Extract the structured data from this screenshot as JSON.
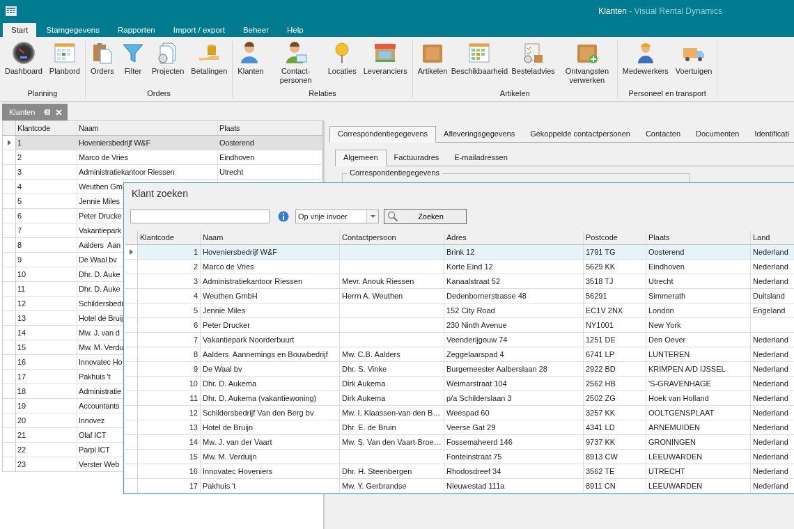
{
  "window": {
    "title": "Klanten",
    "app": "- Visual Rental Dynamics"
  },
  "menu_tabs": [
    {
      "label": "Start",
      "selected": true
    },
    {
      "label": "Stamgegevens",
      "selected": false
    },
    {
      "label": "Rapporten",
      "selected": false
    },
    {
      "label": "Import / export",
      "selected": false
    },
    {
      "label": "Beheer",
      "selected": false
    },
    {
      "label": "Help",
      "selected": false
    }
  ],
  "ribbon": [
    {
      "group": "Planning",
      "buttons": [
        "Dashboard",
        "Planbord"
      ]
    },
    {
      "group": "Orders",
      "buttons": [
        "Orders",
        "Filter",
        "Projecten",
        "Betalingen"
      ]
    },
    {
      "group": "Relaties",
      "buttons": [
        "Klanten",
        "Contact-personen",
        "Locaties",
        "Leveranciers"
      ]
    },
    {
      "group": "Artikelen",
      "buttons": [
        "Artikelen",
        "Beschikbaarheid",
        "Besteladvies",
        "Ontvangsten verwerken"
      ]
    },
    {
      "group": "Personeel en transport",
      "buttons": [
        "Medewerkers",
        "Voertuigen"
      ]
    }
  ],
  "document_tab": {
    "label": "Klanten"
  },
  "list": {
    "columns": [
      "Klantcode",
      "Naam",
      "Plaats"
    ],
    "rows": [
      {
        "cells": [
          "1",
          "Hoveniersbedrijf W&F",
          "Oosterend"
        ],
        "selected": true
      },
      {
        "cells": [
          "2",
          "Marco de Vries",
          "Eindhoven"
        ],
        "selected": false
      },
      {
        "cells": [
          "3",
          "Administratiekantoor Riessen",
          "Utrecht"
        ],
        "selected": false
      },
      {
        "cells": [
          "4",
          "Weuthen Gm"
        ],
        "selected": false
      },
      {
        "cells": [
          "5",
          "Jennie Miles"
        ],
        "selected": false
      },
      {
        "cells": [
          "6",
          "Peter Drucke"
        ],
        "selected": false
      },
      {
        "cells": [
          "7",
          "Vakantiepark"
        ],
        "selected": false
      },
      {
        "cells": [
          "8",
          "Aalders  Aan"
        ],
        "selected": false
      },
      {
        "cells": [
          "9",
          "De Waal bv"
        ],
        "selected": false
      },
      {
        "cells": [
          "10",
          "Dhr. D. Auke"
        ],
        "selected": false
      },
      {
        "cells": [
          "11",
          "Dhr. D. Auke"
        ],
        "selected": false
      },
      {
        "cells": [
          "12",
          "Schildersbedr"
        ],
        "selected": false
      },
      {
        "cells": [
          "13",
          "Hotel de Bruij"
        ],
        "selected": false
      },
      {
        "cells": [
          "14",
          "Mw. J. van d"
        ],
        "selected": false
      },
      {
        "cells": [
          "15",
          "Mw. M. Verdu"
        ],
        "selected": false
      },
      {
        "cells": [
          "16",
          "Innovatec Ho"
        ],
        "selected": false
      },
      {
        "cells": [
          "17",
          "Pakhuis 't"
        ],
        "selected": false
      },
      {
        "cells": [
          "18",
          "Administratie"
        ],
        "selected": false
      },
      {
        "cells": [
          "19",
          "Accountants"
        ],
        "selected": false
      },
      {
        "cells": [
          "20",
          "Innovez"
        ],
        "selected": false
      },
      {
        "cells": [
          "21",
          "Olaf ICT"
        ],
        "selected": false
      },
      {
        "cells": [
          "22",
          "Parpi ICT"
        ],
        "selected": false
      },
      {
        "cells": [
          "23",
          "Verster Web"
        ],
        "selected": false
      }
    ]
  },
  "detail_tabs": [
    {
      "label": "Correspondentiegegevens",
      "selected": true
    },
    {
      "label": "Afleveringsgegevens",
      "selected": false
    },
    {
      "label": "Gekoppelde contactpersonen",
      "selected": false
    },
    {
      "label": "Contacten",
      "selected": false
    },
    {
      "label": "Documenten",
      "selected": false
    },
    {
      "label": "Identificati",
      "selected": false
    }
  ],
  "sub_tabs": [
    {
      "label": "Algemeen",
      "selected": true
    },
    {
      "label": "Factuuradres",
      "selected": false
    },
    {
      "label": "E-mailadressen",
      "selected": false
    }
  ],
  "group_box": {
    "title": "Correspondentiegegevens"
  },
  "dialog": {
    "title": "Klant zoeken",
    "search_mode": "Op vrije invoer",
    "search_button": "Zoeken",
    "columns": [
      "Klantcode",
      "Naam",
      "Contactpersoon",
      "Adres",
      "Postcode",
      "Plaats",
      "Land"
    ],
    "rows": [
      {
        "cells": [
          "1",
          "Hoveniersbedrijf W&F",
          "",
          "Brink 12",
          "1791 TG",
          "Oosterend",
          "Nederland"
        ],
        "selected": true
      },
      {
        "cells": [
          "2",
          "Marco de Vries",
          "",
          "Korte Eind 12",
          "5629 KK",
          "Eindhoven",
          "Nederland"
        ],
        "selected": false
      },
      {
        "cells": [
          "3",
          "Administratiekantoor Riessen",
          "Mevr. Anouk Riessen",
          "Kanaalstraat 52",
          "3518 TJ",
          "Utrecht",
          "Nederland"
        ],
        "selected": false
      },
      {
        "cells": [
          "4",
          "Weuthen GmbH",
          "Herrn A. Weuthen",
          "Dedenbornerstrasse 48",
          "56291",
          "Simmerath",
          "Duitsland"
        ],
        "selected": false
      },
      {
        "cells": [
          "5",
          "Jennie Miles",
          "",
          "152 City Road",
          "EC1V 2NX",
          "London",
          "Engeland"
        ],
        "selected": false
      },
      {
        "cells": [
          "6",
          "Peter Drucker",
          "",
          "230 Ninth Avenue",
          "NY1001",
          "New York",
          ""
        ],
        "selected": false
      },
      {
        "cells": [
          "7",
          "Vakantiepark Noorderbuurt",
          "",
          "Veenderijgouw 74",
          "1251 DE",
          "Den Oever",
          "Nederland"
        ],
        "selected": false
      },
      {
        "cells": [
          "8",
          "Aalders  Aannemings en Bouwbedrijf",
          "Mw. C.B. Aalders",
          "Zeggelaarspad 4",
          "6741 LP",
          "LUNTEREN",
          "Nederland"
        ],
        "selected": false
      },
      {
        "cells": [
          "9",
          "De Waal bv",
          "Dhr. S. Vinke",
          "Burgemeester Aalberslaan 28",
          "2922 BD",
          "KRIMPEN A/D IJSSEL",
          "Nederland"
        ],
        "selected": false
      },
      {
        "cells": [
          "10",
          "Dhr. D. Aukema",
          "Dirk Aukema",
          "Weimarstraat 104",
          "2562 HB",
          "'S-GRAVENHAGE",
          "Nederland"
        ],
        "selected": false
      },
      {
        "cells": [
          "11",
          "Dhr. D. Aukema (vakantiewoning)",
          "Dirk Aukema",
          "p/a Schilderslaan 3",
          "2502 ZG",
          "Hoek van Holland",
          "Nederland"
        ],
        "selected": false
      },
      {
        "cells": [
          "12",
          "Schildersbedrijf Van den Berg bv",
          "Mw. I. Klaassen-van den B…",
          "Weespad 60",
          "3257 KK",
          "OOLTGENSPLAAT",
          "Nederland"
        ],
        "selected": false
      },
      {
        "cells": [
          "13",
          "Hotel de Bruijn",
          "Dhr. E. de Bruin",
          "Veerse Gat 29",
          "4341 LD",
          "ARNEMUIDEN",
          "Nederland"
        ],
        "selected": false
      },
      {
        "cells": [
          "14",
          "Mw. J. van der Vaart",
          "Mw. S. Van den Vaart-Broe…",
          "Fossemaheerd 146",
          "9737 KK",
          "GRONINGEN",
          "Nederland"
        ],
        "selected": false
      },
      {
        "cells": [
          "15",
          "Mw. M. Verduijn",
          "",
          "Fonteinstraat 75",
          "8913 CW",
          "LEEUWARDEN",
          "Nederland"
        ],
        "selected": false
      },
      {
        "cells": [
          "16",
          "Innovatec Hoveniers",
          "Dhr. H. Steenbergen",
          "Rhodosdreef 34",
          "3562 TE",
          "UTRECHT",
          "Nederland"
        ],
        "selected": false
      },
      {
        "cells": [
          "17",
          "Pakhuis 't",
          "Mw. Y. Gerbrandse",
          "Nieuwestad 111a",
          "8911 CN",
          "LEEUWARDEN",
          "Nederland"
        ],
        "selected": false
      }
    ]
  }
}
